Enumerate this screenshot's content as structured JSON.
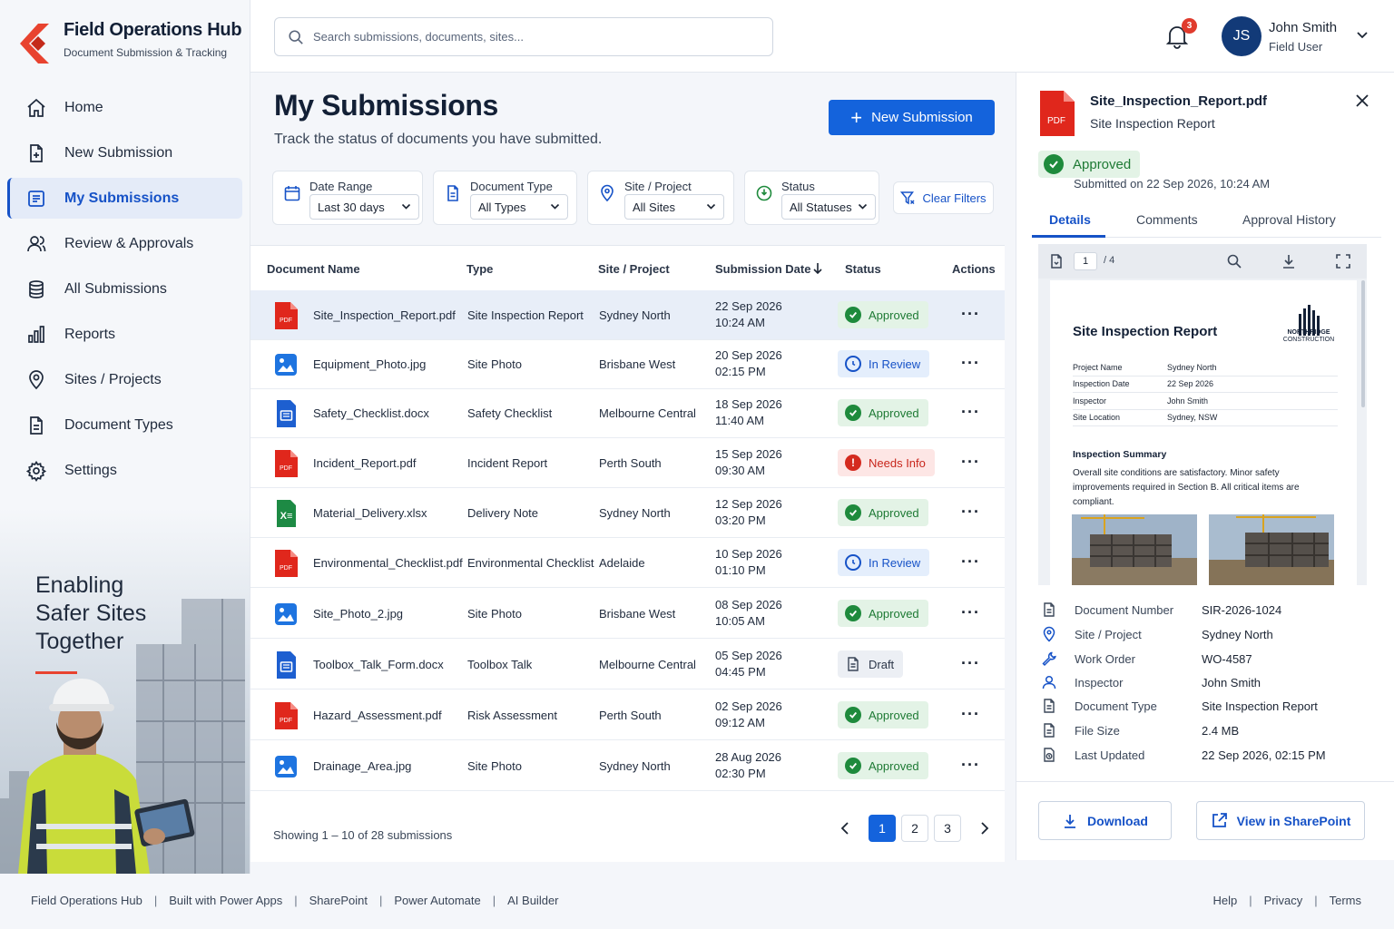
{
  "brand": {
    "title": "Field Operations Hub",
    "subtitle": "Document Submission & Tracking"
  },
  "nav": [
    {
      "label": "Home",
      "icon": "home-icon"
    },
    {
      "label": "New Submission",
      "icon": "file-plus-icon"
    },
    {
      "label": "My Submissions",
      "icon": "list-icon",
      "active": true
    },
    {
      "label": "Review & Approvals",
      "icon": "users-icon"
    },
    {
      "label": "All Submissions",
      "icon": "database-icon"
    },
    {
      "label": "Reports",
      "icon": "bar-chart-icon"
    },
    {
      "label": "Sites / Projects",
      "icon": "location-pin-icon"
    },
    {
      "label": "Document Types",
      "icon": "document-icon"
    },
    {
      "label": "Settings",
      "icon": "gear-icon"
    }
  ],
  "hero": {
    "line1": "Enabling",
    "line2": "Safer Sites",
    "line3": "Together"
  },
  "search": {
    "placeholder": "Search submissions, documents, sites..."
  },
  "notifications": {
    "count": "3"
  },
  "user": {
    "initials": "JS",
    "name": "John Smith",
    "role": "Field User"
  },
  "page": {
    "title": "My Submissions",
    "subtitle": "Track the status of documents you have submitted.",
    "new_button": "New Submission"
  },
  "filters": {
    "date": {
      "label": "Date Range",
      "value": "Last 30 days"
    },
    "type": {
      "label": "Document Type",
      "value": "All Types"
    },
    "site": {
      "label": "Site / Project",
      "value": "All Sites"
    },
    "status": {
      "label": "Status",
      "value": "All Statuses"
    },
    "clear": "Clear Filters"
  },
  "table": {
    "headers": {
      "name": "Document Name",
      "type": "Type",
      "site": "Site / Project",
      "date": "Submission Date",
      "status": "Status",
      "actions": "Actions"
    },
    "rows": [
      {
        "file": "Site_Inspection_Report.pdf",
        "ftype": "pdf",
        "type": "Site Inspection Report",
        "site": "Sydney North",
        "date": "22 Sep 2026",
        "time": "10:24 AM",
        "status": "Approved"
      },
      {
        "file": "Equipment_Photo.jpg",
        "ftype": "img",
        "type": "Site Photo",
        "site": "Brisbane West",
        "date": "20 Sep 2026",
        "time": "02:15 PM",
        "status": "In Review"
      },
      {
        "file": "Safety_Checklist.docx",
        "ftype": "doc",
        "type": "Safety Checklist",
        "site": "Melbourne Central",
        "date": "18 Sep 2026",
        "time": "11:40 AM",
        "status": "Approved"
      },
      {
        "file": "Incident_Report.pdf",
        "ftype": "pdf",
        "type": "Incident Report",
        "site": "Perth South",
        "date": "15 Sep 2026",
        "time": "09:30 AM",
        "status": "Needs Info"
      },
      {
        "file": "Material_Delivery.xlsx",
        "ftype": "xls",
        "type": "Delivery Note",
        "site": "Sydney North",
        "date": "12 Sep 2026",
        "time": "03:20 PM",
        "status": "Approved"
      },
      {
        "file": "Environmental_Checklist.pdf",
        "ftype": "pdf",
        "type": "Environmental Checklist",
        "site": "Adelaide",
        "date": "10 Sep 2026",
        "time": "01:10 PM",
        "status": "In Review"
      },
      {
        "file": "Site_Photo_2.jpg",
        "ftype": "img",
        "type": "Site Photo",
        "site": "Brisbane West",
        "date": "08 Sep 2026",
        "time": "10:05 AM",
        "status": "Approved"
      },
      {
        "file": "Toolbox_Talk_Form.docx",
        "ftype": "doc",
        "type": "Toolbox Talk",
        "site": "Melbourne Central",
        "date": "05 Sep 2026",
        "time": "04:45 PM",
        "status": "Draft"
      },
      {
        "file": "Hazard_Assessment.pdf",
        "ftype": "pdf",
        "type": "Risk Assessment",
        "site": "Perth South",
        "date": "02 Sep 2026",
        "time": "09:12 AM",
        "status": "Approved"
      },
      {
        "file": "Drainage_Area.jpg",
        "ftype": "img",
        "type": "Site Photo",
        "site": "Sydney North",
        "date": "28 Aug 2026",
        "time": "02:30 PM",
        "status": "Approved"
      }
    ]
  },
  "pagination": {
    "summary": "Showing 1 – 10 of 28 submissions",
    "pages": [
      "1",
      "2",
      "3"
    ]
  },
  "panel": {
    "file": "Site_Inspection_Report.pdf",
    "doc_type": "Site Inspection Report",
    "status": "Approved",
    "submitted": "Submitted on 22 Sep 2026, 10:24 AM",
    "tabs": [
      "Details",
      "Comments",
      "Approval History"
    ],
    "viewer": {
      "page": "1",
      "total": "/ 4"
    },
    "preview": {
      "title": "Site Inspection Report",
      "logo_line1": "NORTHRIDGE",
      "logo_line2": "CONSTRUCTION",
      "fields": [
        {
          "k": "Project Name",
          "v": "Sydney North"
        },
        {
          "k": "Inspection Date",
          "v": "22 Sep 2026"
        },
        {
          "k": "Inspector",
          "v": "John Smith"
        },
        {
          "k": "Site Location",
          "v": "Sydney, NSW"
        }
      ],
      "summary_heading": "Inspection Summary",
      "summary": "Overall site conditions are satisfactory. Minor safety improvements required in Section B. All critical items are compliant."
    },
    "meta": [
      {
        "k": "Document Number",
        "v": "SIR-2026-1024",
        "icon": "document-icon"
      },
      {
        "k": "Site / Project",
        "v": "Sydney North",
        "icon": "location-pin-icon"
      },
      {
        "k": "Work Order",
        "v": "WO-4587",
        "icon": "wrench-icon"
      },
      {
        "k": "Inspector",
        "v": "John Smith",
        "icon": "user-icon"
      },
      {
        "k": "Document Type",
        "v": "Site Inspection Report",
        "icon": "document-icon"
      },
      {
        "k": "File Size",
        "v": "2.4 MB",
        "icon": "file-icon"
      },
      {
        "k": "Last Updated",
        "v": "22 Sep 2026, 02:15 PM",
        "icon": "clock-file-icon"
      }
    ],
    "download": "Download",
    "sharepoint": "View in SharePoint"
  },
  "footer": {
    "left": [
      "Field Operations Hub",
      "Built with Power Apps",
      "SharePoint",
      "Power Automate",
      "AI Builder"
    ],
    "right": [
      "Help",
      "Privacy",
      "Terms"
    ]
  },
  "colors": {
    "accent": "#1463dc",
    "approved": "#1e8a3c",
    "review": "#1652c7",
    "needs_info": "#d42a1f",
    "brand_red": "#e8432f"
  }
}
